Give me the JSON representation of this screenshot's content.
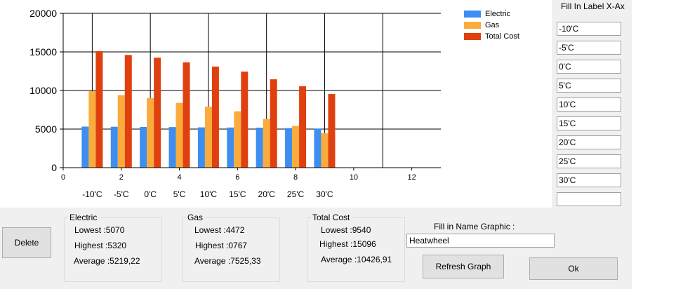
{
  "chart_data": {
    "type": "bar",
    "x_ticks": [
      "0",
      "2",
      "4",
      "6",
      "8",
      "10",
      "12"
    ],
    "y_ticks": [
      "0",
      "5000",
      "10000",
      "15000",
      "20000"
    ],
    "xlim": [
      0,
      13
    ],
    "ylim": [
      0,
      20000
    ],
    "categories": [
      "-10'C",
      "-5'C",
      "0'C",
      "5'C",
      "10'C",
      "15'C",
      "20'C",
      "25'C",
      "30'C"
    ],
    "category_x": [
      1,
      2,
      3,
      4,
      5,
      6,
      7,
      8,
      9
    ],
    "series": [
      {
        "name": "Electric",
        "color": "#3d8ef0",
        "values": [
          5320,
          5300,
          5280,
          5260,
          5220,
          5200,
          5180,
          5130,
          5070
        ]
      },
      {
        "name": "Gas",
        "color": "#f9ac3c",
        "values": [
          9900,
          9400,
          9000,
          8400,
          7900,
          7300,
          6300,
          5400,
          4472
        ]
      },
      {
        "name": "Total Cost",
        "color": "#e0400f",
        "values": [
          15096,
          14600,
          14250,
          13650,
          13100,
          12450,
          11450,
          10550,
          9540
        ]
      }
    ],
    "legend_position": "top-right",
    "grid": true
  },
  "right_panel": {
    "title": "Fill In Label X-Ax",
    "labels": [
      "-10'C",
      "-5'C",
      "0'C",
      "5'C",
      "10'C",
      "15'C",
      "20'C",
      "25'C",
      "30'C",
      "",
      "",
      ""
    ]
  },
  "buttons": {
    "delete": "Delete",
    "refresh": "Refresh  Graph",
    "ok": "Ok"
  },
  "stats": {
    "electric": {
      "title": "Electric",
      "lowest": "Lowest :5070",
      "highest": "Highest :5320",
      "average": "Average :5219,22"
    },
    "gas": {
      "title": "Gas",
      "lowest": "Lowest :4472",
      "highest": "Highest :0767",
      "average": "Average :7525,33"
    },
    "total": {
      "title": "Total Cost",
      "lowest": "Lowest :9540",
      "highest": "Highest :15096",
      "average": "Average :10426,91"
    }
  },
  "name_graphic": {
    "label": "Fill in Name Graphic :",
    "value": "Heatwheel"
  }
}
